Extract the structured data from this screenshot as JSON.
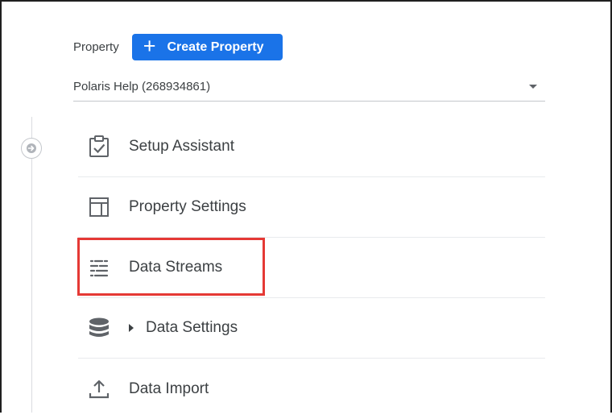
{
  "property": {
    "label": "Property",
    "create_button_icon": "+",
    "create_button_label": "Create Property",
    "selected": "Polaris Help (268934861)"
  },
  "menu": {
    "items": [
      {
        "label": "Setup Assistant",
        "icon": "clipboard-check-icon"
      },
      {
        "label": "Property Settings",
        "icon": "layout-icon"
      },
      {
        "label": "Data Streams",
        "icon": "data-streams-icon",
        "highlighted": true
      },
      {
        "label": "Data Settings",
        "icon": "database-icon",
        "expandable": true
      },
      {
        "label": "Data Import",
        "icon": "upload-icon"
      }
    ]
  },
  "colors": {
    "accent": "#1a73e8",
    "highlight": "#e53935",
    "text": "#3c4043",
    "icon": "#5f6368"
  }
}
